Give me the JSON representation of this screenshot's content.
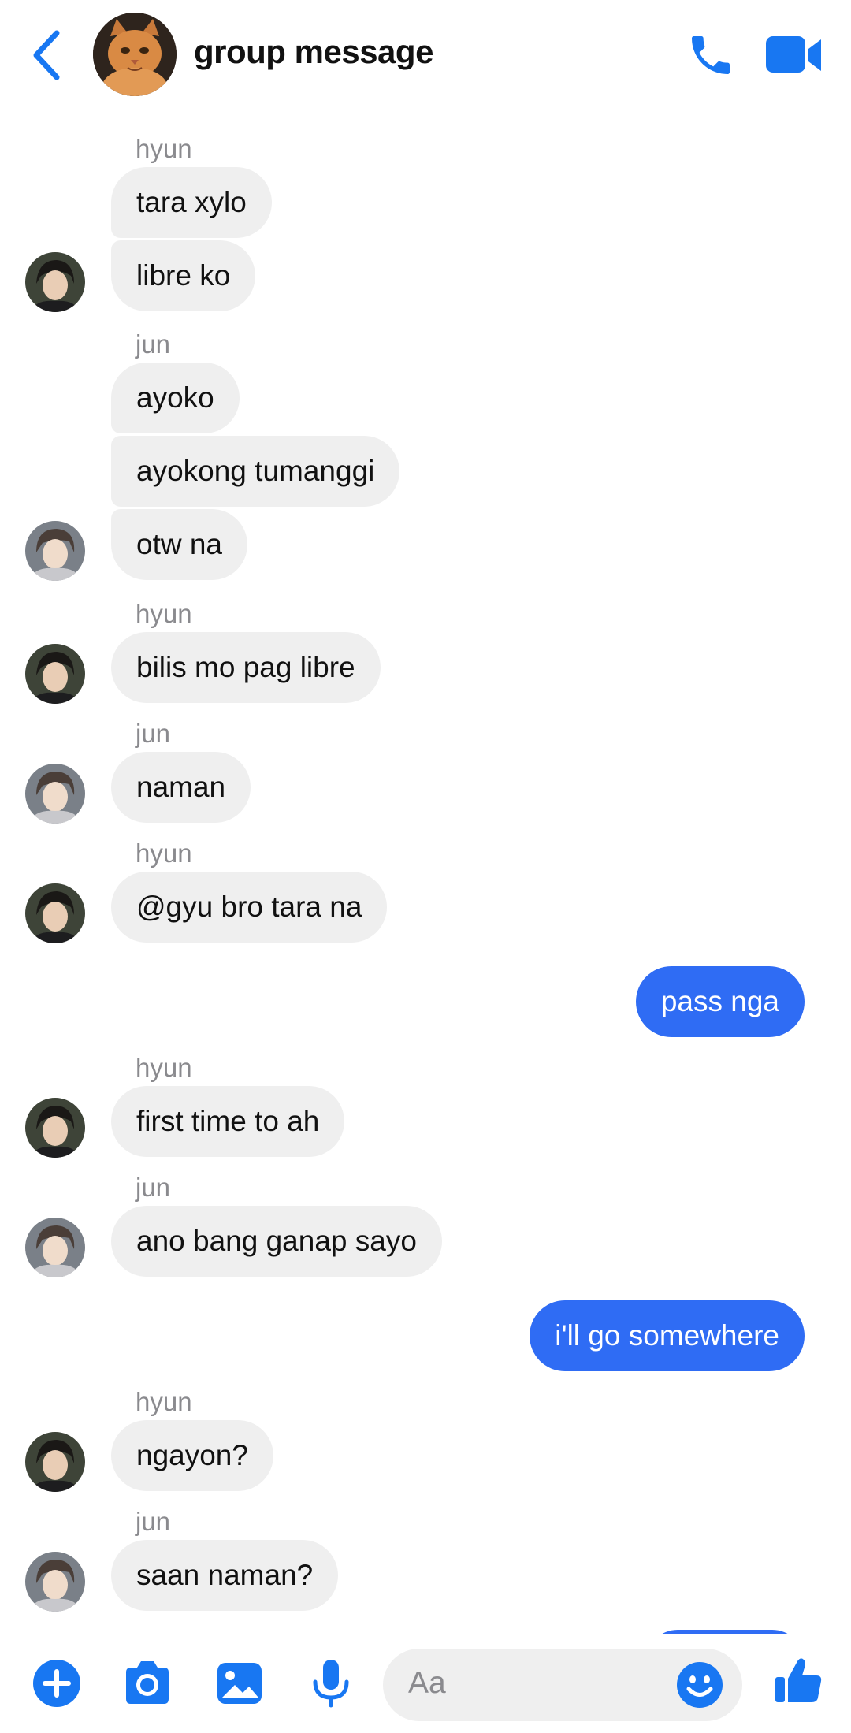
{
  "header": {
    "title": "group message",
    "back_icon": "chevron-left-icon",
    "call_icon": "phone-icon",
    "video_icon": "video-camera-icon"
  },
  "messages": [
    {
      "sender": "hyun",
      "bubbles": [
        "tara xylo",
        "libre ko"
      ]
    },
    {
      "sender": "jun",
      "bubbles": [
        "ayoko",
        "ayokong tumanggi",
        "otw na"
      ]
    },
    {
      "sender": "hyun",
      "bubbles": [
        "bilis mo pag libre"
      ]
    },
    {
      "sender": "jun",
      "bubbles": [
        "naman"
      ]
    },
    {
      "sender": "hyun",
      "bubbles": [
        "@gyu bro tara na"
      ]
    },
    {
      "sender": "me",
      "bubbles": [
        "pass nga"
      ]
    },
    {
      "sender": "hyun",
      "bubbles": [
        "first time to ah"
      ]
    },
    {
      "sender": "jun",
      "bubbles": [
        "ano bang ganap sayo"
      ]
    },
    {
      "sender": "me",
      "bubbles": [
        "i'll go somewhere"
      ]
    },
    {
      "sender": "hyun",
      "bubbles": [
        "ngayon?"
      ]
    },
    {
      "sender": "jun",
      "bubbles": [
        "saan naman?"
      ]
    }
  ],
  "composer": {
    "placeholder": "Aa",
    "icons": [
      "plus-circle-icon",
      "camera-icon",
      "image-icon",
      "microphone-icon",
      "emoji-icon",
      "thumbs-up-icon"
    ]
  },
  "colors": {
    "accent": "#2f6cf4",
    "incoming_bubble": "#efefef",
    "sender_label": "#8a8a8e"
  }
}
